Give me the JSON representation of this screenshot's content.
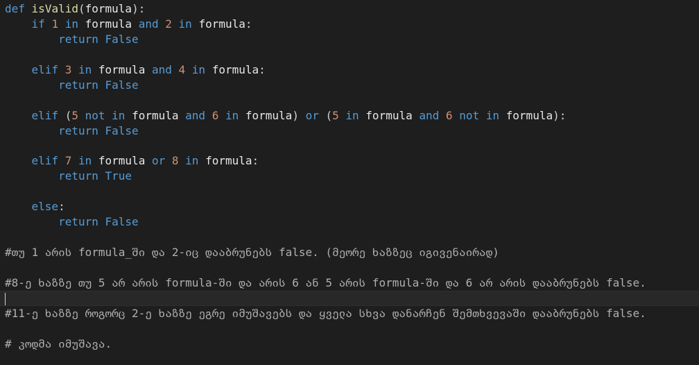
{
  "code_lines": [
    {
      "indent": "",
      "tokens": [
        {
          "t": "kw",
          "v": "def"
        },
        {
          "t": "pn",
          "v": " "
        },
        {
          "t": "fn",
          "v": "isValid"
        },
        {
          "t": "pn",
          "v": "("
        },
        {
          "t": "idn",
          "v": "formula"
        },
        {
          "t": "pn",
          "v": "):"
        }
      ]
    },
    {
      "indent": "    ",
      "tokens": [
        {
          "t": "kw",
          "v": "if"
        },
        {
          "t": "pn",
          "v": " "
        },
        {
          "t": "num",
          "v": "1"
        },
        {
          "t": "pn",
          "v": " "
        },
        {
          "t": "kw",
          "v": "in"
        },
        {
          "t": "pn",
          "v": " "
        },
        {
          "t": "idn",
          "v": "formula"
        },
        {
          "t": "pn",
          "v": " "
        },
        {
          "t": "kw",
          "v": "and"
        },
        {
          "t": "pn",
          "v": " "
        },
        {
          "t": "num",
          "v": "2"
        },
        {
          "t": "pn",
          "v": " "
        },
        {
          "t": "kw",
          "v": "in"
        },
        {
          "t": "pn",
          "v": " "
        },
        {
          "t": "idn",
          "v": "formula"
        },
        {
          "t": "pn",
          "v": ":"
        }
      ]
    },
    {
      "indent": "        ",
      "tokens": [
        {
          "t": "kw",
          "v": "return"
        },
        {
          "t": "pn",
          "v": " "
        },
        {
          "t": "kw",
          "v": "False"
        }
      ]
    },
    {
      "indent": "",
      "tokens": []
    },
    {
      "indent": "    ",
      "tokens": [
        {
          "t": "kw",
          "v": "elif"
        },
        {
          "t": "pn",
          "v": " "
        },
        {
          "t": "num",
          "v": "3"
        },
        {
          "t": "pn",
          "v": " "
        },
        {
          "t": "kw",
          "v": "in"
        },
        {
          "t": "pn",
          "v": " "
        },
        {
          "t": "idn",
          "v": "formula"
        },
        {
          "t": "pn",
          "v": " "
        },
        {
          "t": "kw",
          "v": "and"
        },
        {
          "t": "pn",
          "v": " "
        },
        {
          "t": "num",
          "v": "4"
        },
        {
          "t": "pn",
          "v": " "
        },
        {
          "t": "kw",
          "v": "in"
        },
        {
          "t": "pn",
          "v": " "
        },
        {
          "t": "idn",
          "v": "formula"
        },
        {
          "t": "pn",
          "v": ":"
        }
      ]
    },
    {
      "indent": "        ",
      "tokens": [
        {
          "t": "kw",
          "v": "return"
        },
        {
          "t": "pn",
          "v": " "
        },
        {
          "t": "kw",
          "v": "False"
        }
      ]
    },
    {
      "indent": "",
      "tokens": []
    },
    {
      "indent": "    ",
      "tokens": [
        {
          "t": "kw",
          "v": "elif"
        },
        {
          "t": "pn",
          "v": " ("
        },
        {
          "t": "num",
          "v": "5"
        },
        {
          "t": "pn",
          "v": " "
        },
        {
          "t": "kw",
          "v": "not"
        },
        {
          "t": "pn",
          "v": " "
        },
        {
          "t": "kw",
          "v": "in"
        },
        {
          "t": "pn",
          "v": " "
        },
        {
          "t": "idn",
          "v": "formula"
        },
        {
          "t": "pn",
          "v": " "
        },
        {
          "t": "kw",
          "v": "and"
        },
        {
          "t": "pn",
          "v": " "
        },
        {
          "t": "num",
          "v": "6"
        },
        {
          "t": "pn",
          "v": " "
        },
        {
          "t": "kw",
          "v": "in"
        },
        {
          "t": "pn",
          "v": " "
        },
        {
          "t": "idn",
          "v": "formula"
        },
        {
          "t": "pn",
          "v": ") "
        },
        {
          "t": "kw",
          "v": "or"
        },
        {
          "t": "pn",
          "v": " ("
        },
        {
          "t": "num",
          "v": "5"
        },
        {
          "t": "pn",
          "v": " "
        },
        {
          "t": "kw",
          "v": "in"
        },
        {
          "t": "pn",
          "v": " "
        },
        {
          "t": "idn",
          "v": "formula"
        },
        {
          "t": "pn",
          "v": " "
        },
        {
          "t": "kw",
          "v": "and"
        },
        {
          "t": "pn",
          "v": " "
        },
        {
          "t": "num",
          "v": "6"
        },
        {
          "t": "pn",
          "v": " "
        },
        {
          "t": "kw",
          "v": "not"
        },
        {
          "t": "pn",
          "v": " "
        },
        {
          "t": "kw",
          "v": "in"
        },
        {
          "t": "pn",
          "v": " "
        },
        {
          "t": "idn",
          "v": "formula"
        },
        {
          "t": "pn",
          "v": "):"
        }
      ]
    },
    {
      "indent": "        ",
      "tokens": [
        {
          "t": "kw",
          "v": "return"
        },
        {
          "t": "pn",
          "v": " "
        },
        {
          "t": "kw",
          "v": "False"
        }
      ]
    },
    {
      "indent": "",
      "tokens": []
    },
    {
      "indent": "    ",
      "tokens": [
        {
          "t": "kw",
          "v": "elif"
        },
        {
          "t": "pn",
          "v": " "
        },
        {
          "t": "num",
          "v": "7"
        },
        {
          "t": "pn",
          "v": " "
        },
        {
          "t": "kw",
          "v": "in"
        },
        {
          "t": "pn",
          "v": " "
        },
        {
          "t": "idn",
          "v": "formula"
        },
        {
          "t": "pn",
          "v": " "
        },
        {
          "t": "kw",
          "v": "or"
        },
        {
          "t": "pn",
          "v": " "
        },
        {
          "t": "num",
          "v": "8"
        },
        {
          "t": "pn",
          "v": " "
        },
        {
          "t": "kw",
          "v": "in"
        },
        {
          "t": "pn",
          "v": " "
        },
        {
          "t": "idn",
          "v": "formula"
        },
        {
          "t": "pn",
          "v": ":"
        }
      ]
    },
    {
      "indent": "        ",
      "tokens": [
        {
          "t": "kw",
          "v": "return"
        },
        {
          "t": "pn",
          "v": " "
        },
        {
          "t": "kw",
          "v": "True"
        }
      ]
    },
    {
      "indent": "",
      "tokens": []
    },
    {
      "indent": "    ",
      "tokens": [
        {
          "t": "kw",
          "v": "else"
        },
        {
          "t": "pn",
          "v": ":"
        }
      ]
    },
    {
      "indent": "        ",
      "tokens": [
        {
          "t": "kw",
          "v": "return"
        },
        {
          "t": "pn",
          "v": " "
        },
        {
          "t": "kw",
          "v": "False"
        }
      ]
    },
    {
      "indent": "",
      "tokens": []
    },
    {
      "indent": "",
      "tokens": [
        {
          "t": "cm",
          "v": "#თუ 1 არის formula_ში და 2-იც დააბრუნებს false. (მეორე ხაზზეც იგივენაირად)"
        }
      ]
    },
    {
      "indent": "",
      "tokens": []
    },
    {
      "indent": "",
      "tokens": [
        {
          "t": "cm",
          "v": "#8-ე ხაზზე თუ 5 არ არის formula-ში და არის 6 ან 5 არის formula-ში და 6 არ არის დააბრუნებს false."
        }
      ]
    },
    {
      "indent": "",
      "current": true,
      "tokens": []
    },
    {
      "indent": "",
      "tokens": [
        {
          "t": "cm",
          "v": "#11-ე ხაზზე როგორც 2-ე ხაზზე ეგრე იმუშავებს და ყველა სხვა დანარჩენ შემთხვევაში დააბრუნებს false."
        }
      ]
    },
    {
      "indent": "",
      "tokens": []
    },
    {
      "indent": "",
      "tokens": [
        {
          "t": "cm",
          "v": "# კოდმა იმუშავა."
        }
      ]
    }
  ],
  "colors": {
    "background": "#1e1e1e",
    "keyword": "#569cd6",
    "function": "#dcdcaa",
    "number": "#ce9178",
    "identifier": "#e8e8e8",
    "comment": "#b0b0b0"
  }
}
